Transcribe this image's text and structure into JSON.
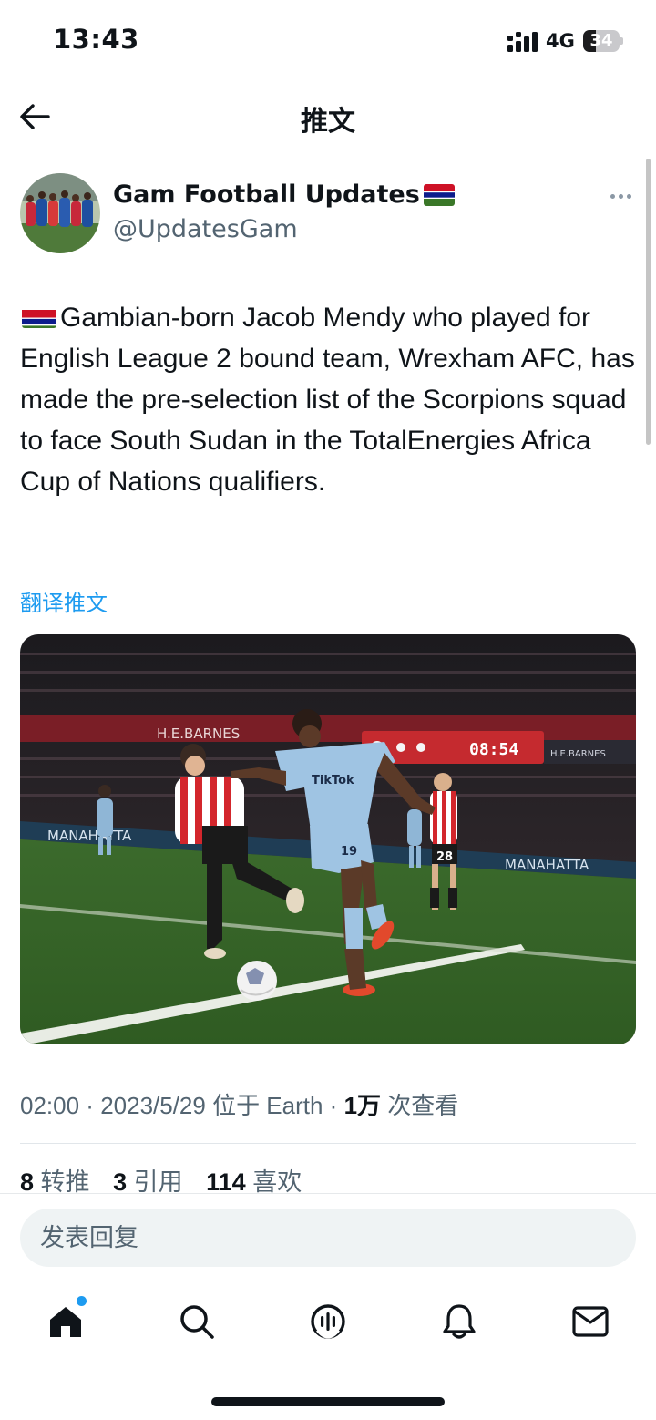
{
  "status_bar": {
    "time": "13:43",
    "network": "4G",
    "battery": "34",
    "battery_level": 0.34,
    "icons": [
      "signal-icon",
      "battery-icon"
    ]
  },
  "header": {
    "title": "推文",
    "back_icon": "arrow-left-icon"
  },
  "tweet": {
    "author_name": "Gam Football Updates",
    "author_handle": "@UpdatesGam",
    "text": "Gambian-born Jacob Mendy who played for English League 2 bound team, Wrexham AFC, has made the pre-selection list of the Scorpions squad to face South Sudan in the TotalEnergies Africa Cup of Nations qualifiers.",
    "translate_label": "翻译推文",
    "image_text": {
      "ad_board_left": "H.E.BARNES",
      "scoreboard": "08:54",
      "sponsor_right": "H.E.BARNES",
      "shirt_sponsor": "TikTok",
      "player_number": "19",
      "opponent_number": "28",
      "pitch_board_left": "MANAHATTA",
      "pitch_board_right": "MANAHATTA"
    },
    "meta": {
      "time": "02:00",
      "sep1": " · ",
      "date": "2023/5/29",
      "location": " 位于 Earth",
      "sep2": " · ",
      "views": "1万",
      "views_label": " 次查看"
    },
    "stats": {
      "retweets": "8",
      "retweets_label": "转推",
      "quotes": "3",
      "quotes_label": "引用",
      "likes": "114",
      "likes_label": "喜欢"
    }
  },
  "reply": {
    "placeholder": "发表回复"
  },
  "tab_bar": {
    "items": [
      "home-icon",
      "search-icon",
      "spaces-icon",
      "notifications-icon",
      "messages-icon"
    ],
    "home_badge": true
  },
  "colors": {
    "accent": "#1d9bf0",
    "text": "#0f1419",
    "secondary": "#536471",
    "gambia_red": "#ce1126",
    "gambia_blue": "#0c1c8c",
    "gambia_green": "#3a7728"
  }
}
